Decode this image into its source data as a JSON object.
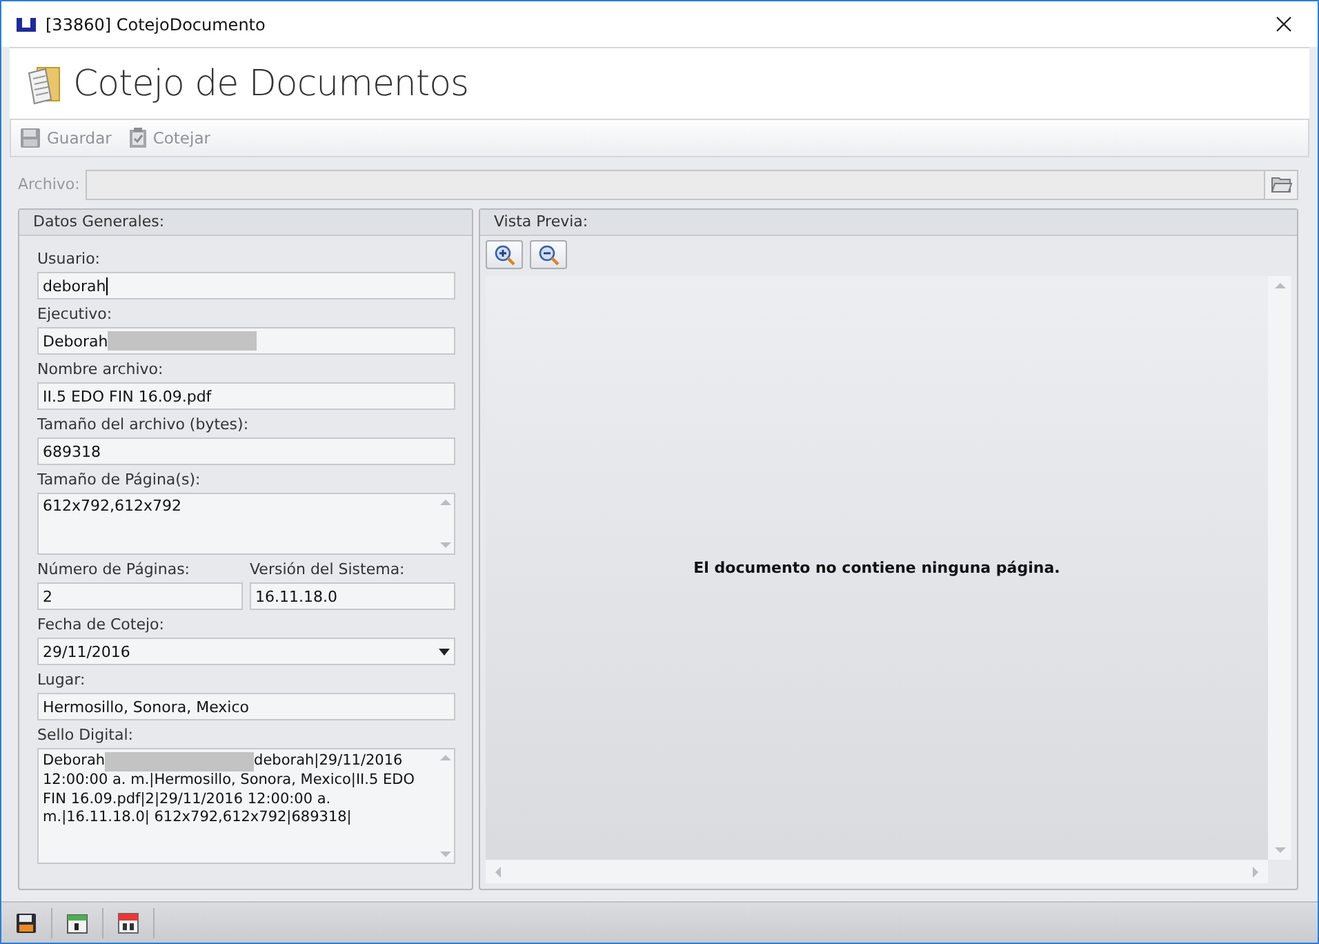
{
  "window": {
    "title": "[33860] CotejoDocumento"
  },
  "header": {
    "title": "Cotejo de Documentos"
  },
  "toolbar": [
    {
      "label": "Guardar",
      "kind": "save",
      "disabled": true
    },
    {
      "label": "Cotejar",
      "kind": "clipboard",
      "disabled": true
    }
  ],
  "archivo": {
    "label": "Archivo:",
    "disabled": true
  },
  "general": {
    "title": "Datos Generales:",
    "fields": [
      {
        "kind": "text",
        "label": "Usuario:",
        "value": "deborah",
        "focused": true
      },
      {
        "kind": "text",
        "label": "Ejecutivo:",
        "value": "Deborah",
        "redacted": true
      },
      {
        "kind": "text",
        "label": "Nombre archivo:",
        "value": "II.5 EDO FIN 16.09.pdf"
      },
      {
        "kind": "text",
        "label": "Tamaño del archivo (bytes):",
        "value": "689318"
      },
      {
        "kind": "memo",
        "label": "Tamaño de Página(s):",
        "value": "612x792,612x792"
      },
      {
        "kind": "row",
        "fields": [
          {
            "kind": "text",
            "label": "Número de Páginas:",
            "value": "2"
          },
          {
            "kind": "text",
            "label": "Versión del Sistema:",
            "value": "16.11.18.0"
          }
        ]
      },
      {
        "kind": "date",
        "label": "Fecha de Cotejo:",
        "value": "29/11/2016"
      },
      {
        "kind": "text",
        "label": "Lugar:",
        "value": "Hermosillo, Sonora, Mexico"
      },
      {
        "kind": "seal",
        "label": "Sello Digital:",
        "value": "Deborah",
        "redacted": true,
        "value_after": "deborah|29/11/2016",
        "value_rest": "12:00:00 a. m.|Hermosillo, Sonora, Mexico|II.5 EDO FIN 16.09.pdf|2|29/11/2016 12:00:00 a. m.|16.11.18.0| 612x792,612x792|689318|"
      }
    ]
  },
  "preview": {
    "title": "Vista Previa:",
    "message": "El documento no contiene ninguna página."
  },
  "bottom_toolbar": [
    {
      "kind": "save"
    },
    {
      "kind": "calendar-day"
    },
    {
      "kind": "calendar-month"
    }
  ]
}
